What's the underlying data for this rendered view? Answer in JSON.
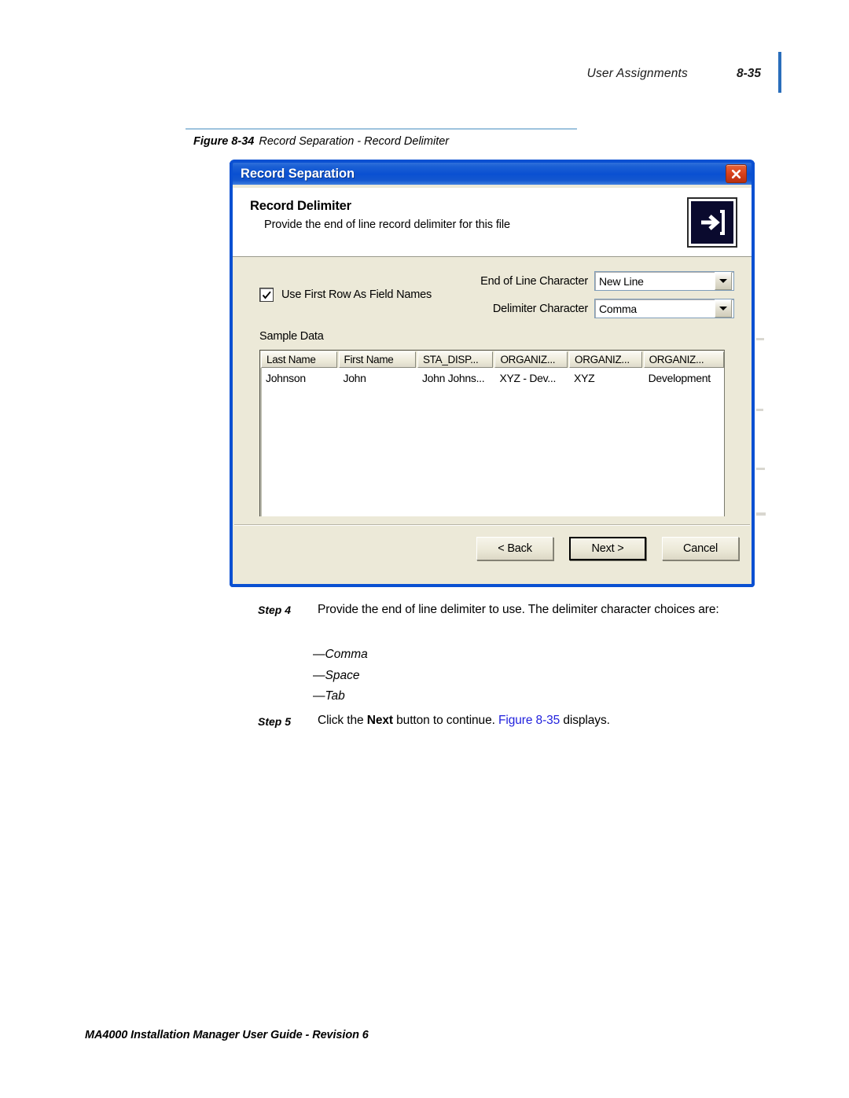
{
  "page": {
    "header_title": "User Assignments",
    "header_page_number": "8-35",
    "footer": "MA4000 Installation Manager User Guide - Revision 6",
    "accent_color": "#2a6ebb",
    "rule_color": "#9dc3de"
  },
  "figure": {
    "label": "Figure 8-34",
    "title": "Record Separation - Record Delimiter"
  },
  "dialog": {
    "titlebar": {
      "title": "Record Separation",
      "close_icon": "close-x-icon",
      "background_color": "#0a50d2",
      "close_color": "#d9421c"
    },
    "header": {
      "heading": "Record Delimiter",
      "subheading": "Provide the end of line record delimiter for this file",
      "icon": "arrow-right-into-box-icon"
    },
    "checkbox": {
      "label": "Use First Row As Field Names",
      "checked": true,
      "icon": "checkmark-icon"
    },
    "sample_data_label": "Sample Data",
    "combos": [
      {
        "label": "End of Line Character",
        "value": "New Line",
        "arrow_icon": "chevron-down-icon"
      },
      {
        "label": "Delimiter Character",
        "value": "Comma",
        "arrow_icon": "chevron-down-icon"
      }
    ],
    "grid": {
      "columns": [
        "Last Name",
        "First Name",
        "STA_DISP...",
        "ORGANIZ...",
        "ORGANIZ...",
        "ORGANIZ..."
      ],
      "rows": [
        [
          "Johnson",
          "John",
          "John Johns...",
          "XYZ - Dev...",
          "XYZ",
          "Development"
        ]
      ]
    },
    "scrollbar": {
      "left_icon": "chevron-left-icon",
      "right_icon": "chevron-right-icon",
      "grip": "|||"
    },
    "buttons": {
      "back": "< Back",
      "next": "Next >",
      "cancel": "Cancel"
    }
  },
  "steps": [
    {
      "label": "Step  4",
      "text": "Provide the end of line delimiter to use. The delimiter character choices are:"
    },
    {
      "label": "Step  5",
      "prefix": "Click the ",
      "bold": "Next",
      "middle": " button to continue. ",
      "link": "Figure 8-35",
      "suffix": " displays."
    }
  ],
  "bullets": [
    {
      "dash": "—",
      "text": "Comma"
    },
    {
      "dash": "—",
      "text": "Space"
    },
    {
      "dash": "—",
      "text": "Tab"
    }
  ]
}
